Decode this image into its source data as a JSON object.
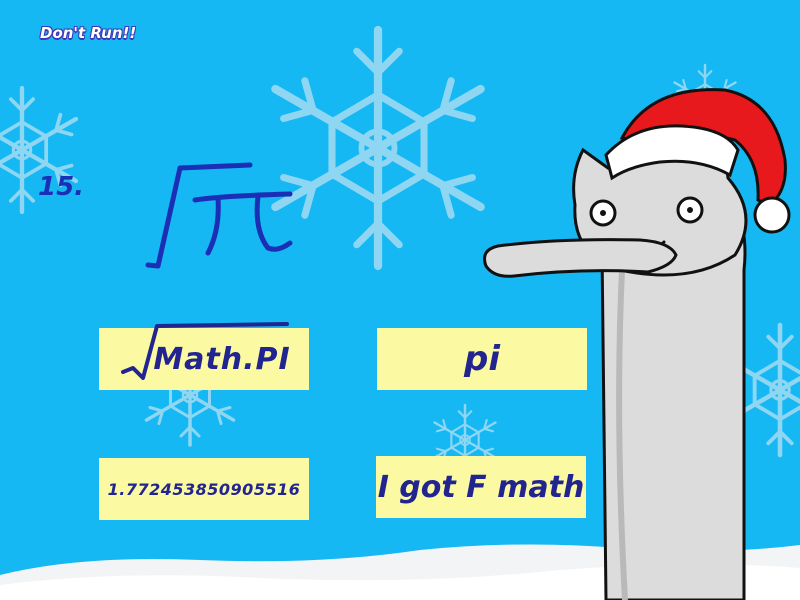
{
  "title": "Don't Run!!",
  "question": {
    "number": "15.",
    "expression_icon": "square-root-of-pi"
  },
  "answers": [
    {
      "label": "Math.PI",
      "prefix_icon": "square-root-sign"
    },
    {
      "label": "pi"
    },
    {
      "label": "1.772453850905516"
    },
    {
      "label": "I got F math"
    }
  ],
  "colors": {
    "background": "#15b8f3",
    "snowflake": "#8fd6f3",
    "answer_box": "#fbf9a2",
    "answer_text": "#22248f",
    "question_ink": "#1a2fb5",
    "cat_body": "#dcdcdc",
    "santa_hat": "#e8191c"
  }
}
